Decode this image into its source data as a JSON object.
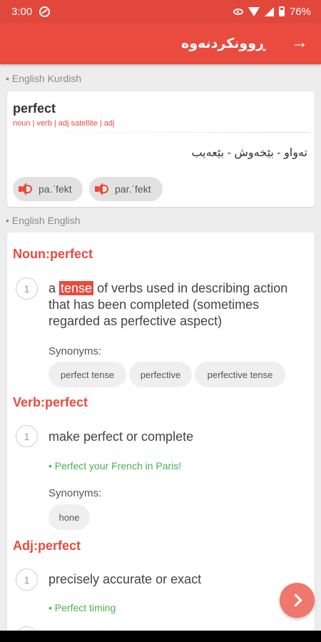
{
  "status": {
    "time": "3:00",
    "battery": "76%"
  },
  "appbar": {
    "title": "ڕوونکردنەوە",
    "icon": "arrow-right-icon"
  },
  "sections": {
    "english_kurdish": "• English Kurdish",
    "english_english": "• English English"
  },
  "entry": {
    "word": "perfect",
    "pos": "noun | verb | adj satellite | adj",
    "translation": "تەواو - بێخەوش - بێعەیب",
    "pronunciations": [
      "pa.ˈfekt",
      "par.ˈfekt"
    ]
  },
  "noun": {
    "heading": "Noun:perfect",
    "number": "1",
    "def_before": "a ",
    "def_highlight": "tense",
    "def_after": " of verbs used in describing action that has been completed (sometimes regarded as perfective aspect)",
    "synonyms_label": "Synonyms:",
    "synonyms": [
      "perfect tense",
      "perfective",
      "perfective tense"
    ]
  },
  "verb": {
    "heading": "Verb:perfect",
    "number": "1",
    "definition": "make perfect or complete",
    "example": "• Perfect your French in Paris!",
    "synonyms_label": "Synonyms:",
    "synonyms": [
      "hone"
    ]
  },
  "adj": {
    "heading": "Adj:perfect",
    "number": "1",
    "definition": "precisely accurate or exact",
    "example": "• Perfect timing"
  },
  "colors": {
    "accent": "#e94b3f",
    "example": "#4caf50"
  }
}
